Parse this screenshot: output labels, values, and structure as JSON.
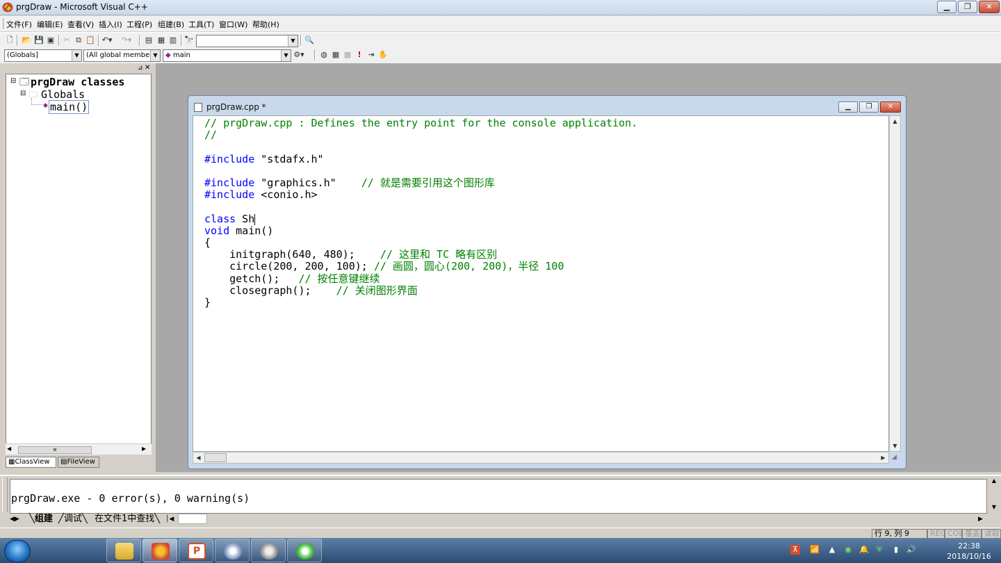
{
  "window": {
    "title": "prgDraw - Microsoft Visual C++"
  },
  "menu": [
    "文件(F)",
    "编辑(E)",
    "查看(V)",
    "插入(I)",
    "工程(P)",
    "组建(B)",
    "工具(T)",
    "窗口(W)",
    "帮助(H)"
  ],
  "toolbar2": {
    "scope_combo": "(Globals]",
    "members_combo": "(All global member",
    "function_combo": "main"
  },
  "workspace": {
    "tree_root": "prgDraw classes",
    "tree_globals": "Globals",
    "tree_main": "main()",
    "tab_classview": "ClassView",
    "tab_fileview": "FileView"
  },
  "editor": {
    "title": "prgDraw.cpp *",
    "lines": [
      {
        "cls": "c-comment",
        "text": "// prgDraw.cpp : Defines the entry point for the console application."
      },
      {
        "cls": "c-comment",
        "text": "//"
      },
      {
        "cls": "c-plain",
        "text": ""
      },
      {
        "cls": "c-kw",
        "text": "#include",
        "rest": " \"stdafx.h\""
      },
      {
        "cls": "c-plain",
        "text": ""
      },
      {
        "cls": "c-kw",
        "text": "#include",
        "rest": " \"graphics.h\"    ",
        "comment": "// 就是需要引用这个图形库"
      },
      {
        "cls": "c-kw",
        "text": "#include",
        "rest": " <conio.h>"
      },
      {
        "cls": "c-plain",
        "text": ""
      },
      {
        "cls": "c-kw",
        "text": "class",
        "rest": " Sh"
      },
      {
        "cls": "c-kw",
        "text": "void",
        "rest": " main()"
      },
      {
        "cls": "c-plain",
        "text": "{"
      },
      {
        "cls": "c-plain",
        "text": "    initgraph(640, 480);    ",
        "comment": "// 这里和 TC 略有区别"
      },
      {
        "cls": "c-plain",
        "text": "    circle(200, 200, 100); ",
        "comment": "// 画圆，圆心(200, 200)，半径 100"
      },
      {
        "cls": "c-plain",
        "text": "    getch();   ",
        "comment": "// 按任意键继续"
      },
      {
        "cls": "c-plain",
        "text": "    closegraph();    ",
        "comment": "// 关闭图形界面"
      },
      {
        "cls": "c-plain",
        "text": "}"
      }
    ]
  },
  "output": {
    "message": "prgDraw.exe - 0 error(s), 0 warning(s)",
    "tabs": [
      "组建",
      "调试",
      "在文件1中查找"
    ]
  },
  "status": {
    "position": "行 9, 列 9",
    "rec": "REC",
    "col": "COL",
    "ovr": "覆盖",
    "read": "读取"
  },
  "clock": {
    "time": "22:38",
    "date": "2018/10/16"
  }
}
